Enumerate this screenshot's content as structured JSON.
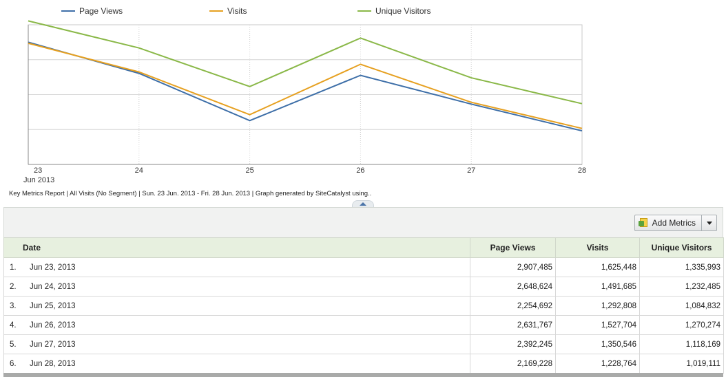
{
  "legend": [
    {
      "name": "Page Views",
      "color": "#3e6fa8"
    },
    {
      "name": "Visits",
      "color": "#e6a020"
    },
    {
      "name": "Unique Visitors",
      "color": "#8ab848"
    }
  ],
  "chart_data": {
    "type": "line",
    "x": [
      "23",
      "24",
      "25",
      "26",
      "27",
      "28"
    ],
    "x_sublabel": "Jun 2013",
    "series": [
      {
        "name": "Page Views",
        "color": "#3e6fa8",
        "values": [
          2907485,
          2648624,
          2254692,
          2631767,
          2392245,
          2169228
        ]
      },
      {
        "name": "Visits",
        "color": "#e6a020",
        "values": [
          1625448,
          1491685,
          1292808,
          1527704,
          1350546,
          1228764
        ]
      },
      {
        "name": "Unique Visitors",
        "color": "#8ab848",
        "values": [
          1335993,
          1232485,
          1084832,
          1270274,
          1118169,
          1019111
        ]
      }
    ],
    "grid": true,
    "legend_position": "top"
  },
  "footer_note": "Key Metrics Report | All Visits (No Segment) | Sun. 23 Jun. 2013 - Fri. 28 Jun. 2013 | Graph generated by SiteCatalyst using..",
  "toolbar": {
    "add_metrics_label": "Add Metrics"
  },
  "table": {
    "headers": {
      "date": "Date",
      "page_views": "Page Views",
      "visits": "Visits",
      "unique_visitors": "Unique Visitors"
    },
    "rows": [
      {
        "rank": "1.",
        "date": "Jun 23, 2013",
        "page_views": "2,907,485",
        "visits": "1,625,448",
        "unique_visitors": "1,335,993"
      },
      {
        "rank": "2.",
        "date": "Jun 24, 2013",
        "page_views": "2,648,624",
        "visits": "1,491,685",
        "unique_visitors": "1,232,485"
      },
      {
        "rank": "3.",
        "date": "Jun 25, 2013",
        "page_views": "2,254,692",
        "visits": "1,292,808",
        "unique_visitors": "1,084,832"
      },
      {
        "rank": "4.",
        "date": "Jun 26, 2013",
        "page_views": "2,631,767",
        "visits": "1,527,704",
        "unique_visitors": "1,270,274"
      },
      {
        "rank": "5.",
        "date": "Jun 27, 2013",
        "page_views": "2,392,245",
        "visits": "1,350,546",
        "unique_visitors": "1,118,169"
      },
      {
        "rank": "6.",
        "date": "Jun 28, 2013",
        "page_views": "2,169,228",
        "visits": "1,228,764",
        "unique_visitors": "1,019,111"
      }
    ]
  }
}
